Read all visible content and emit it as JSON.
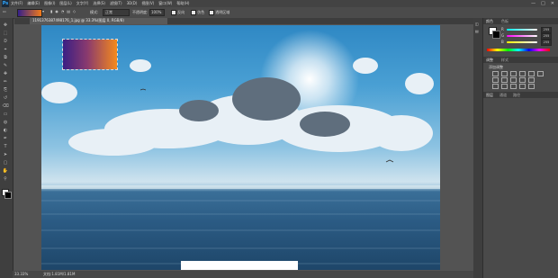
{
  "app": {
    "logo": "Ps"
  },
  "menu": {
    "items": [
      "文件(F)",
      "编辑(E)",
      "图像(I)",
      "图层(L)",
      "文字(Y)",
      "选择(S)",
      "滤镜(T)",
      "3D(D)",
      "视图(V)",
      "窗口(W)",
      "帮助(H)"
    ]
  },
  "window_controls": [
    "—",
    "□",
    "✕"
  ],
  "options_bar": {
    "mode_label": "模式:",
    "mode_value": "正常",
    "opacity_label": "不透明度:",
    "opacity_value": "100%",
    "reverse_label": "反向",
    "dither_label": "仿色",
    "transparency_label": "透明区域"
  },
  "document": {
    "tab_title": "1191376387498176_1.jpg @ 33.3%(图层 0, RGB/8)",
    "zoom": "33.33%",
    "doc_info": "文档:1.81M/1.81M"
  },
  "panels": {
    "color_tab": "颜色",
    "swatches_tab": "色板",
    "adjust_tab": "调整",
    "styles_tab": "样式",
    "add_adjust": "添加调整",
    "layers_tab": "图层",
    "channels_tab": "通道",
    "paths_tab": "路径",
    "rgb": [
      {
        "label": "R",
        "value": "255"
      },
      {
        "label": "G",
        "value": "255"
      },
      {
        "label": "B",
        "value": "255"
      }
    ]
  },
  "tools": [
    "move-tool",
    "marquee-tool",
    "lasso-tool",
    "quick-select-tool",
    "crop-tool",
    "eyedropper-tool",
    "healing-tool",
    "brush-tool",
    "stamp-tool",
    "history-brush-tool",
    "eraser-tool",
    "gradient-tool",
    "blur-tool",
    "dodge-tool",
    "pen-tool",
    "type-tool",
    "path-select-tool",
    "shape-tool",
    "hand-tool",
    "zoom-tool"
  ],
  "colors": {
    "gradient_start": "#35208a",
    "gradient_end": "#f17a1a",
    "foreground": "#ffffff",
    "background": "#000000"
  }
}
